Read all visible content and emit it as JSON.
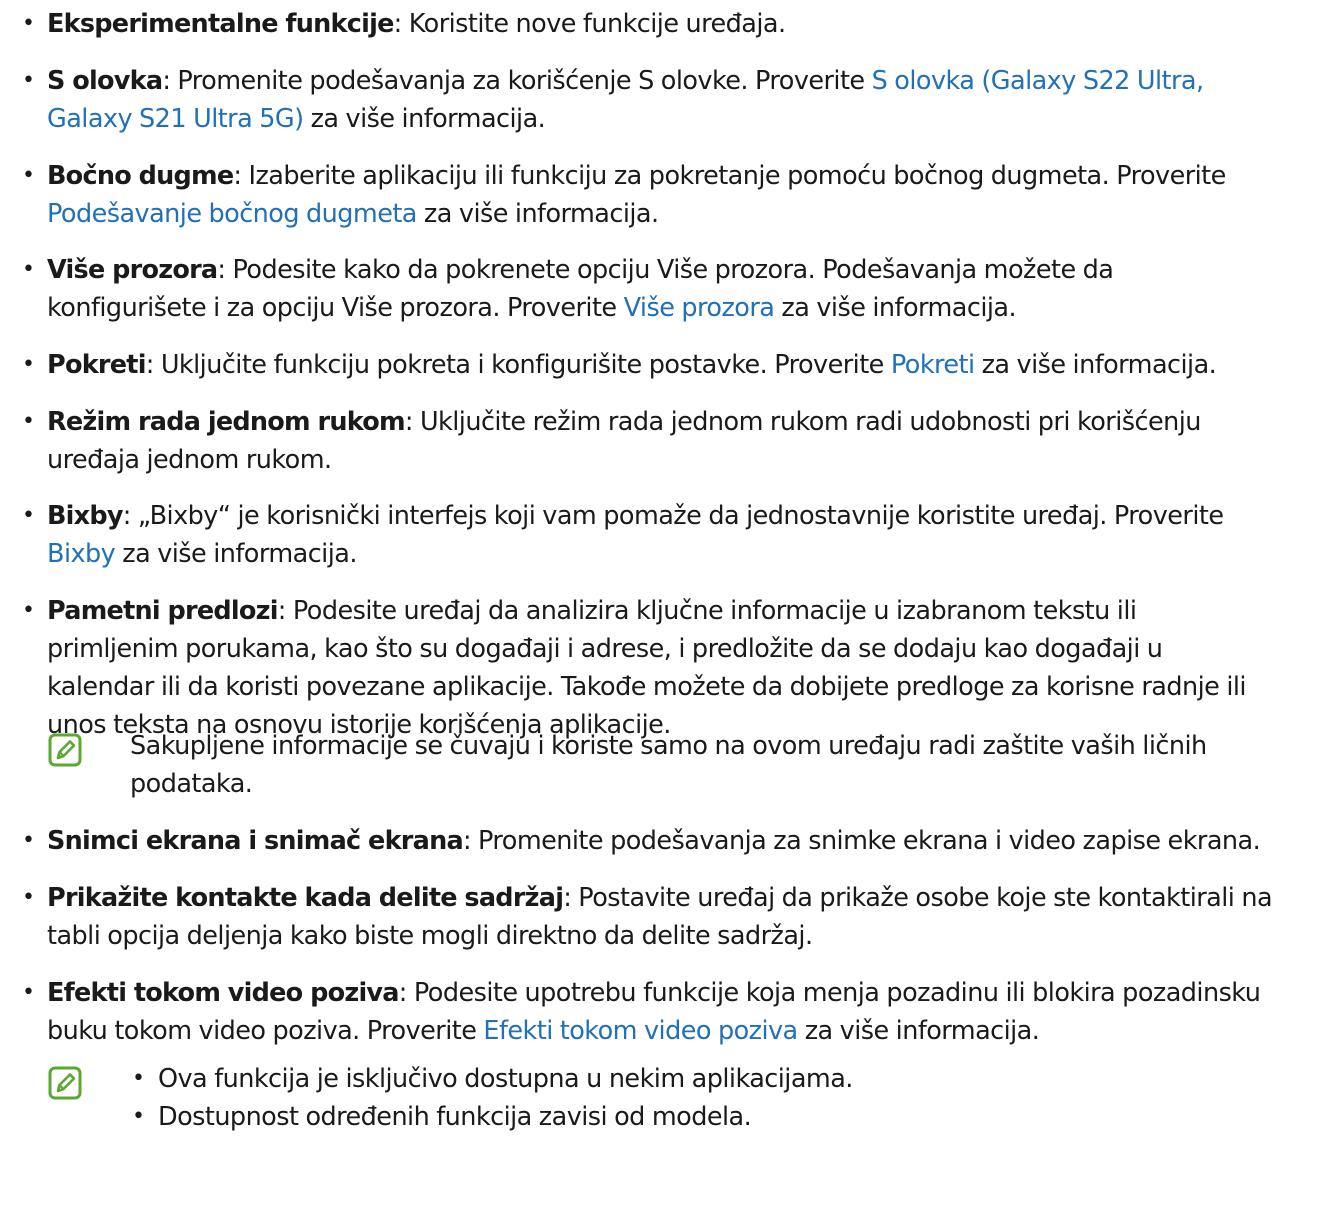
{
  "items": [
    {
      "term": "Eksperimentalne funkcije",
      "lines": [
        [
          {
            "t": ": Koristite nove funkcije uređaja."
          }
        ]
      ]
    },
    {
      "term": "S olovka",
      "lines": [
        [
          {
            "t": ": Promenite podešavanja za korišćenje S olovke. Proverite "
          },
          {
            "t": "S olovka (Galaxy S22 Ultra,",
            "link": true
          }
        ],
        [
          {
            "t": "Galaxy S21 Ultra 5G)",
            "link": true
          },
          {
            "t": " za više informacija."
          }
        ]
      ]
    },
    {
      "term": "Bočno dugme",
      "lines": [
        [
          {
            "t": ": Izaberite aplikaciju ili funkciju za pokretanje pomoću bočnog dugmeta. Proverite"
          }
        ],
        [
          {
            "t": "Podešavanje bočnog dugmeta",
            "link": true
          },
          {
            "t": " za više informacija."
          }
        ]
      ]
    },
    {
      "term": "Više prozora",
      "lines": [
        [
          {
            "t": ": Podesite kako da pokrenete opciju Više prozora. Podešavanja možete da"
          }
        ],
        [
          {
            "t": "konfigurišete i za opciju Više prozora. Proverite "
          },
          {
            "t": "Više prozora",
            "link": true
          },
          {
            "t": " za više informacija."
          }
        ]
      ]
    },
    {
      "term": "Pokreti",
      "lines": [
        [
          {
            "t": ": Uključite funkciju pokreta i konfigurišite postavke. Proverite "
          },
          {
            "t": "Pokreti",
            "link": true
          },
          {
            "t": " za više informacija."
          }
        ]
      ]
    },
    {
      "term": "Režim rada jednom rukom",
      "lines": [
        [
          {
            "t": ": Uključite režim rada jednom rukom radi udobnosti pri korišćenju"
          }
        ],
        [
          {
            "t": "uređaja jednom rukom."
          }
        ]
      ]
    },
    {
      "term": "Bixby",
      "lines": [
        [
          {
            "t": ": „Bixby“ je korisnički interfejs koji vam pomaže da jednostavnije koristite uređaj. Proverite"
          }
        ],
        [
          {
            "t": "Bixby",
            "link": true
          },
          {
            "t": " za više informacija."
          }
        ]
      ]
    },
    {
      "term": "Pametni predlozi",
      "lines": [
        [
          {
            "t": ": Podesite uređaj da analizira ključne informacije u izabranom tekstu ili"
          }
        ],
        [
          {
            "t": "primljenim porukama, kao što su događaji i adrese, i predložite da se dodaju kao događaji u"
          }
        ],
        [
          {
            "t": "kalendar ili da koristi povezane aplikacije. Takođe možete da dobijete predloge za korisne radnje ili"
          }
        ],
        [
          {
            "t": "unos teksta na osnovu istorije korišćenja aplikacije."
          }
        ]
      ]
    },
    {
      "term": "Snimci ekrana i snimač ekrana",
      "lines": [
        [
          {
            "t": ": Promenite podešavanja za snimke ekrana i video zapise ekrana."
          }
        ]
      ]
    },
    {
      "term": "Prikažite kontakte kada delite sadržaj",
      "lines": [
        [
          {
            "t": ": Postavite uređaj da prikaže osobe koje ste kontaktirali na"
          }
        ],
        [
          {
            "t": "tabli opcija deljenja kako biste mogli direktno da delite sadržaj."
          }
        ]
      ]
    },
    {
      "term": "Efekti tokom video poziva",
      "lines": [
        [
          {
            "t": ": Podesite upotrebu funkcije koja menja pozadinu ili blokira pozadinsku"
          }
        ],
        [
          {
            "t": "buku tokom video poziva. Proverite "
          },
          {
            "t": "Efekti tokom video poziva",
            "link": true
          },
          {
            "t": " za više informacija."
          }
        ]
      ]
    }
  ],
  "note1": {
    "icon": "note-pencil-icon",
    "lines": [
      "Sakupljene informacije se čuvaju i koriste samo na ovom uređaju radi zaštite vaših ličnih",
      "podataka."
    ]
  },
  "note2": {
    "icon": "note-pencil-icon",
    "bullets": [
      "Ova funkcija je isključivo dostupna u nekim aplikacijama.",
      "Dostupnost određenih funkcija zavisi od modela."
    ]
  },
  "colors": {
    "link": "#2170b8",
    "icon": "#5aa832",
    "text": "#1a1a1a"
  }
}
